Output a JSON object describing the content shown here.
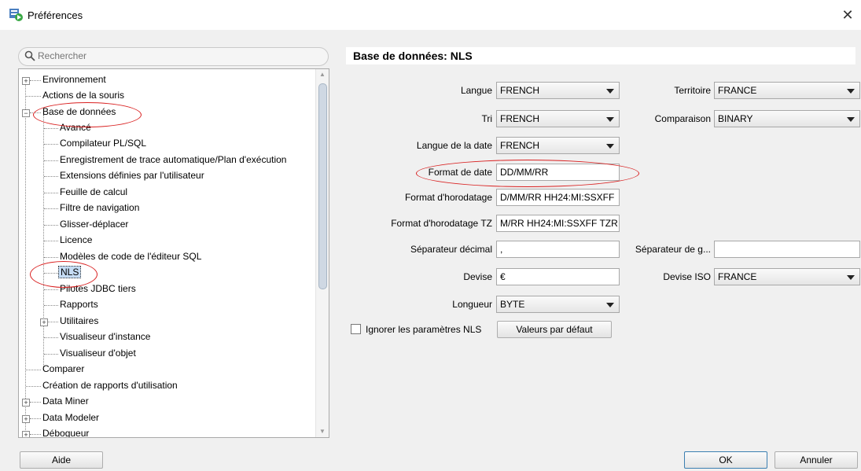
{
  "window": {
    "title": "Préférences",
    "close_symbol": "✕"
  },
  "search": {
    "placeholder": "Rechercher"
  },
  "tree": {
    "items": [
      {
        "label": "Environnement"
      },
      {
        "label": "Actions de la souris"
      },
      {
        "label": "Base de données"
      },
      {
        "label": "Avancé"
      },
      {
        "label": "Compilateur PL/SQL"
      },
      {
        "label": "Enregistrement de trace automatique/Plan d'exécution"
      },
      {
        "label": "Extensions définies par l'utilisateur"
      },
      {
        "label": "Feuille de calcul"
      },
      {
        "label": "Filtre de navigation"
      },
      {
        "label": "Glisser-déplacer"
      },
      {
        "label": "Licence"
      },
      {
        "label": "Modèles de code de l'éditeur SQL"
      },
      {
        "label": "NLS"
      },
      {
        "label": "Pilotes JDBC tiers"
      },
      {
        "label": "Rapports"
      },
      {
        "label": "Utilitaires"
      },
      {
        "label": "Visualiseur d'instance"
      },
      {
        "label": "Visualiseur d'objet"
      },
      {
        "label": "Comparer"
      },
      {
        "label": "Création de rapports d'utilisation"
      },
      {
        "label": "Data Miner"
      },
      {
        "label": "Data Modeler"
      },
      {
        "label": "Débogueur"
      }
    ]
  },
  "panel": {
    "title": "Base de données: NLS",
    "fields": {
      "langue": {
        "label": "Langue",
        "value": "FRENCH"
      },
      "territoire": {
        "label": "Territoire",
        "value": "FRANCE"
      },
      "tri": {
        "label": "Tri",
        "value": "FRENCH"
      },
      "comparaison": {
        "label": "Comparaison",
        "value": "BINARY"
      },
      "langue_date": {
        "label": "Langue de la date",
        "value": "FRENCH"
      },
      "format_date": {
        "label": "Format de date",
        "value": "DD/MM/RR"
      },
      "format_horodatage": {
        "label": "Format d'horodatage",
        "value": "D/MM/RR HH24:MI:SSXFF"
      },
      "format_horodatage_tz": {
        "label": "Format d'horodatage TZ",
        "value": "M/RR HH24:MI:SSXFF TZR"
      },
      "sep_decimal": {
        "label": "Séparateur décimal",
        "value": ","
      },
      "sep_groupe": {
        "label": "Séparateur de g...",
        "value": ""
      },
      "devise": {
        "label": "Devise",
        "value": "€"
      },
      "devise_iso": {
        "label": "Devise ISO",
        "value": "FRANCE"
      },
      "longueur": {
        "label": "Longueur",
        "value": "BYTE"
      }
    },
    "ignore_checkbox": {
      "label": "Ignorer les paramètres NLS",
      "checked": false
    },
    "defaults_button": "Valeurs par défaut"
  },
  "footer": {
    "help": "Aide",
    "ok": "OK",
    "cancel": "Annuler"
  },
  "colors": {
    "annotation": "#d92020",
    "selection": "#c5dcf4",
    "background": "#f0f0f0"
  },
  "icons": [
    "preferences-app-icon",
    "search-icon",
    "close-icon",
    "tree-expand-icon",
    "dropdown-arrow-icon"
  ]
}
